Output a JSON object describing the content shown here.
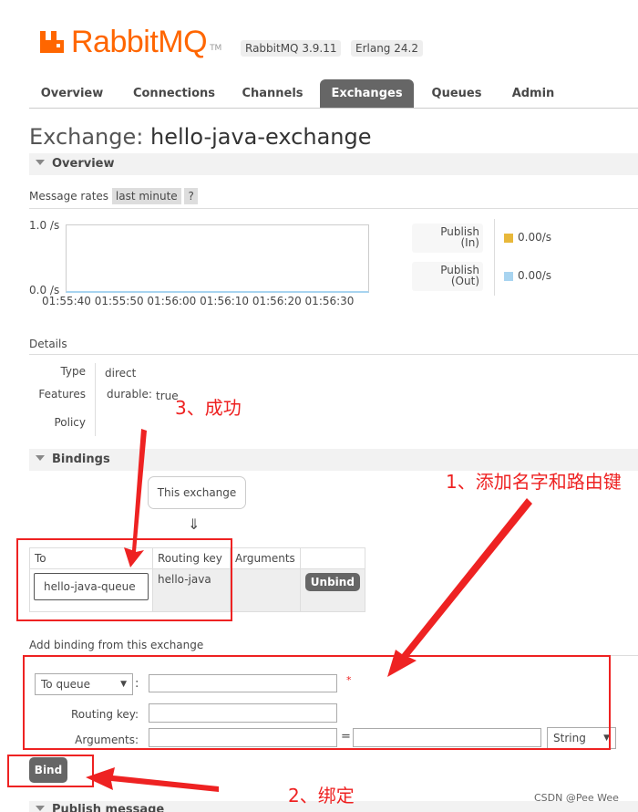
{
  "header": {
    "brand": "RabbitMQ",
    "tm": "TM",
    "versions": [
      "RabbitMQ 3.9.11",
      "Erlang 24.2"
    ]
  },
  "nav": {
    "tabs": [
      "Overview",
      "Connections",
      "Channels",
      "Exchanges",
      "Queues",
      "Admin"
    ],
    "active": "Exchanges"
  },
  "page": {
    "title_label": "Exchange:",
    "exchange_name": "hello-java-exchange"
  },
  "overview": {
    "section_title": "Overview",
    "message_rates_label": "Message rates",
    "period": "last minute",
    "help": "?",
    "y_axis": [
      "1.0 /s",
      "0.0 /s"
    ],
    "x_ticks": "01:55:40 01:55:50 01:56:00 01:56:10 01:56:20 01:56:30",
    "stats": [
      {
        "label1": "Publish",
        "label2": "(In)",
        "value": "0.00/s",
        "color": "#e8b83a"
      },
      {
        "label1": "Publish",
        "label2": "(Out)",
        "value": "0.00/s",
        "color": "#a8d4f0"
      }
    ]
  },
  "details": {
    "title": "Details",
    "type_label": "Type",
    "type_value": "direct",
    "features_label": "Features",
    "durable_label": "durable:",
    "durable_value": "true",
    "policy_label": "Policy"
  },
  "bindings": {
    "section_title": "Bindings",
    "source_bubble": "This exchange",
    "arrow": "⇓",
    "columns": [
      "To",
      "Routing key",
      "Arguments",
      ""
    ],
    "rows": [
      {
        "to": "hello-java-queue",
        "routing_key": "hello-java",
        "arguments": "",
        "action": "Unbind"
      }
    ]
  },
  "add_binding": {
    "title": "Add binding from this exchange",
    "dest_select": "To queue",
    "colon": ":",
    "required_mark": "*",
    "routing_key_label": "Routing key:",
    "arguments_label": "Arguments:",
    "equals": "=",
    "type_select": "String",
    "bind_button": "Bind"
  },
  "next_section": {
    "title": "Publish message"
  },
  "annotations": {
    "step1": "1、添加名字和路由键",
    "step2": "2、绑定",
    "step3": "3、成功"
  },
  "watermark": "CSDN @Pee Wee"
}
